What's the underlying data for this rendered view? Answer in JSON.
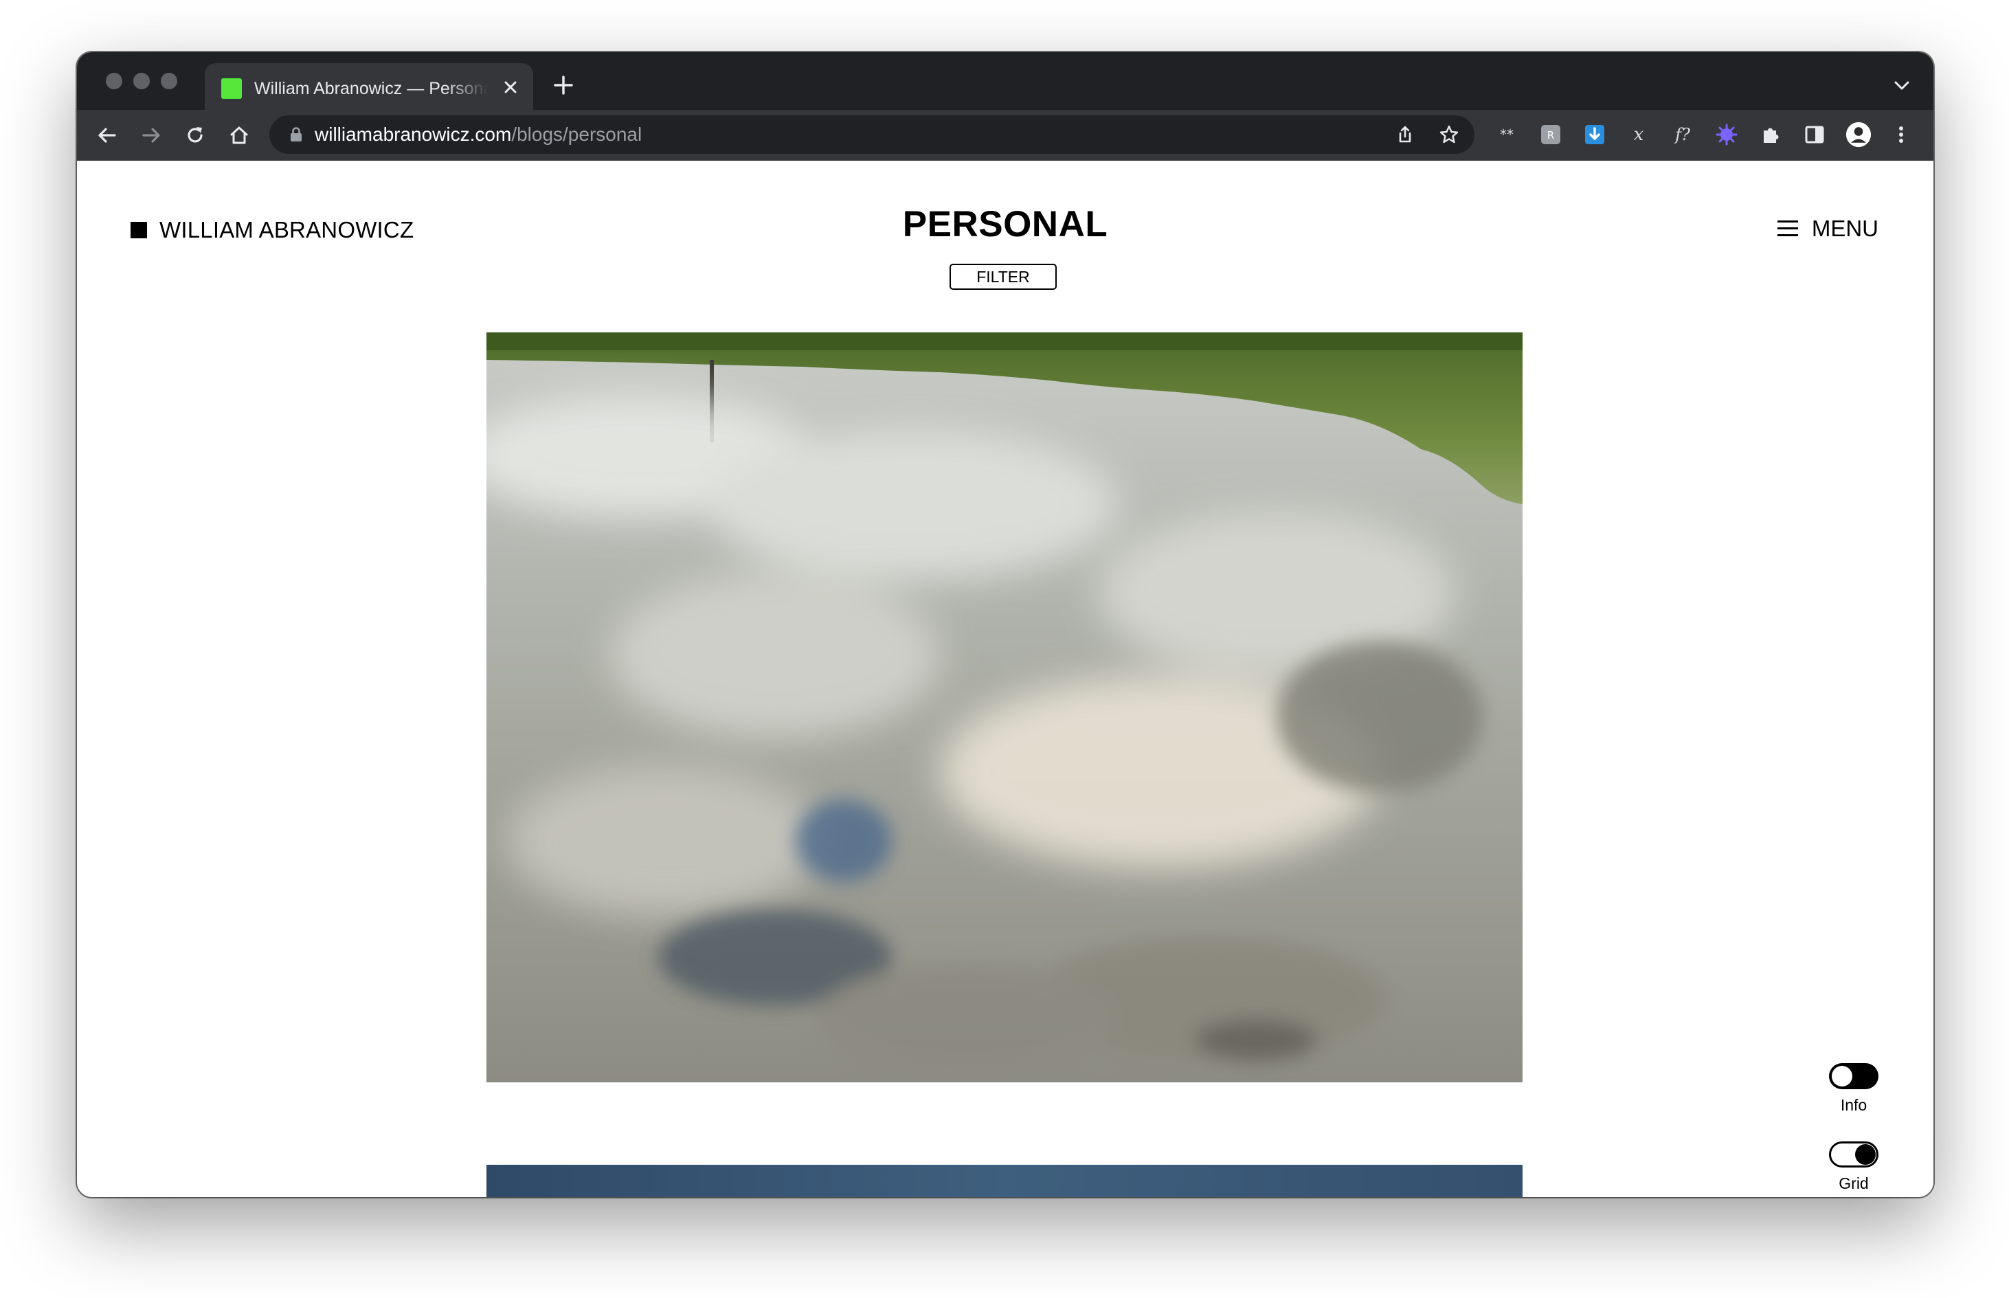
{
  "browser": {
    "tab_title": "William Abranowicz — Personal",
    "favicon_color": "#55e83a",
    "url_host": "williamabranowicz.com",
    "url_path": "/blogs/personal",
    "extensions": [
      "dark-reader-icon",
      "shortcut-icon",
      "download-icon",
      "mathpix-icon",
      "font-finder-icon",
      "color-picker-icon",
      "puzzle-icon",
      "side-panel-icon",
      "profile-avatar-icon"
    ]
  },
  "site": {
    "logo_text": "WILLIAM ABRANOWICZ",
    "page_title": "PERSONAL",
    "filter_label": "FILTER",
    "menu_label": "MENU",
    "toggles": {
      "info": {
        "label": "Info",
        "on": false
      },
      "grid": {
        "label": "Grid",
        "on": true
      }
    }
  }
}
